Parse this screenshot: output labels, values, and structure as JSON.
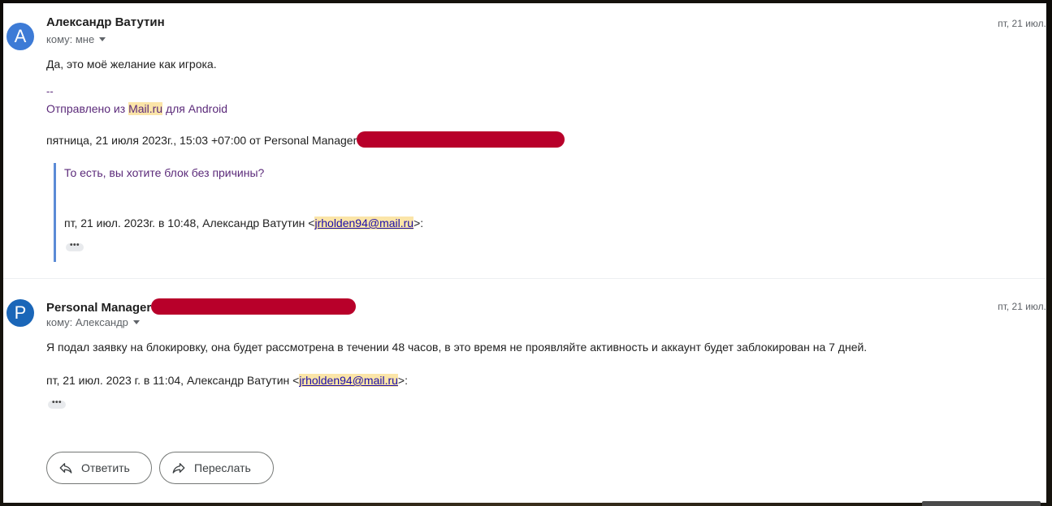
{
  "messages": [
    {
      "avatar_letter": "A",
      "avatar_color": "#3d7bd6",
      "sender": "Александр Ватутин",
      "recipient": "кому: мне",
      "date": "пт, 21 июл.",
      "body": "Да, это моё желание как игрока.",
      "signature_dashes": "--",
      "signature_prefix": "Отправлено из ",
      "signature_link": "Mail.ru",
      "signature_suffix": " для Android",
      "quote_header": "пятница, 21 июля 2023г., 15:03 +07:00 от Personal Manager",
      "quoted_text": "То есть, вы хотите блок без причины?",
      "nested_header_prefix": "пт, 21 июл. 2023г. в 10:48, Александр Ватутин <",
      "nested_header_email": "jrholden94@mail.ru",
      "nested_header_suffix": ">:",
      "ellipsis": "•••"
    },
    {
      "avatar_letter": "P",
      "avatar_color": "#1a66b8",
      "sender": "Personal Manager",
      "recipient": "кому: Александр",
      "date": "пт, 21 июл.",
      "body": "Я подал заявку на блокировку, она будет рассмотрена в течении 48 часов, в это время не проявляйте активность и аккаунт будет заблокирован на 7 дней.",
      "quote_header_prefix": "пт, 21 июл. 2023 г. в 11:04, Александр Ватутин <",
      "quote_header_email": "jrholden94@mail.ru",
      "quote_header_suffix": ">:",
      "ellipsis": "•••"
    }
  ],
  "actions": {
    "reply_label": "Ответить",
    "forward_label": "Переслать"
  },
  "icons": {
    "reply": "reply-icon",
    "forward": "forward-icon",
    "dropdown": "chevron-down-icon"
  }
}
